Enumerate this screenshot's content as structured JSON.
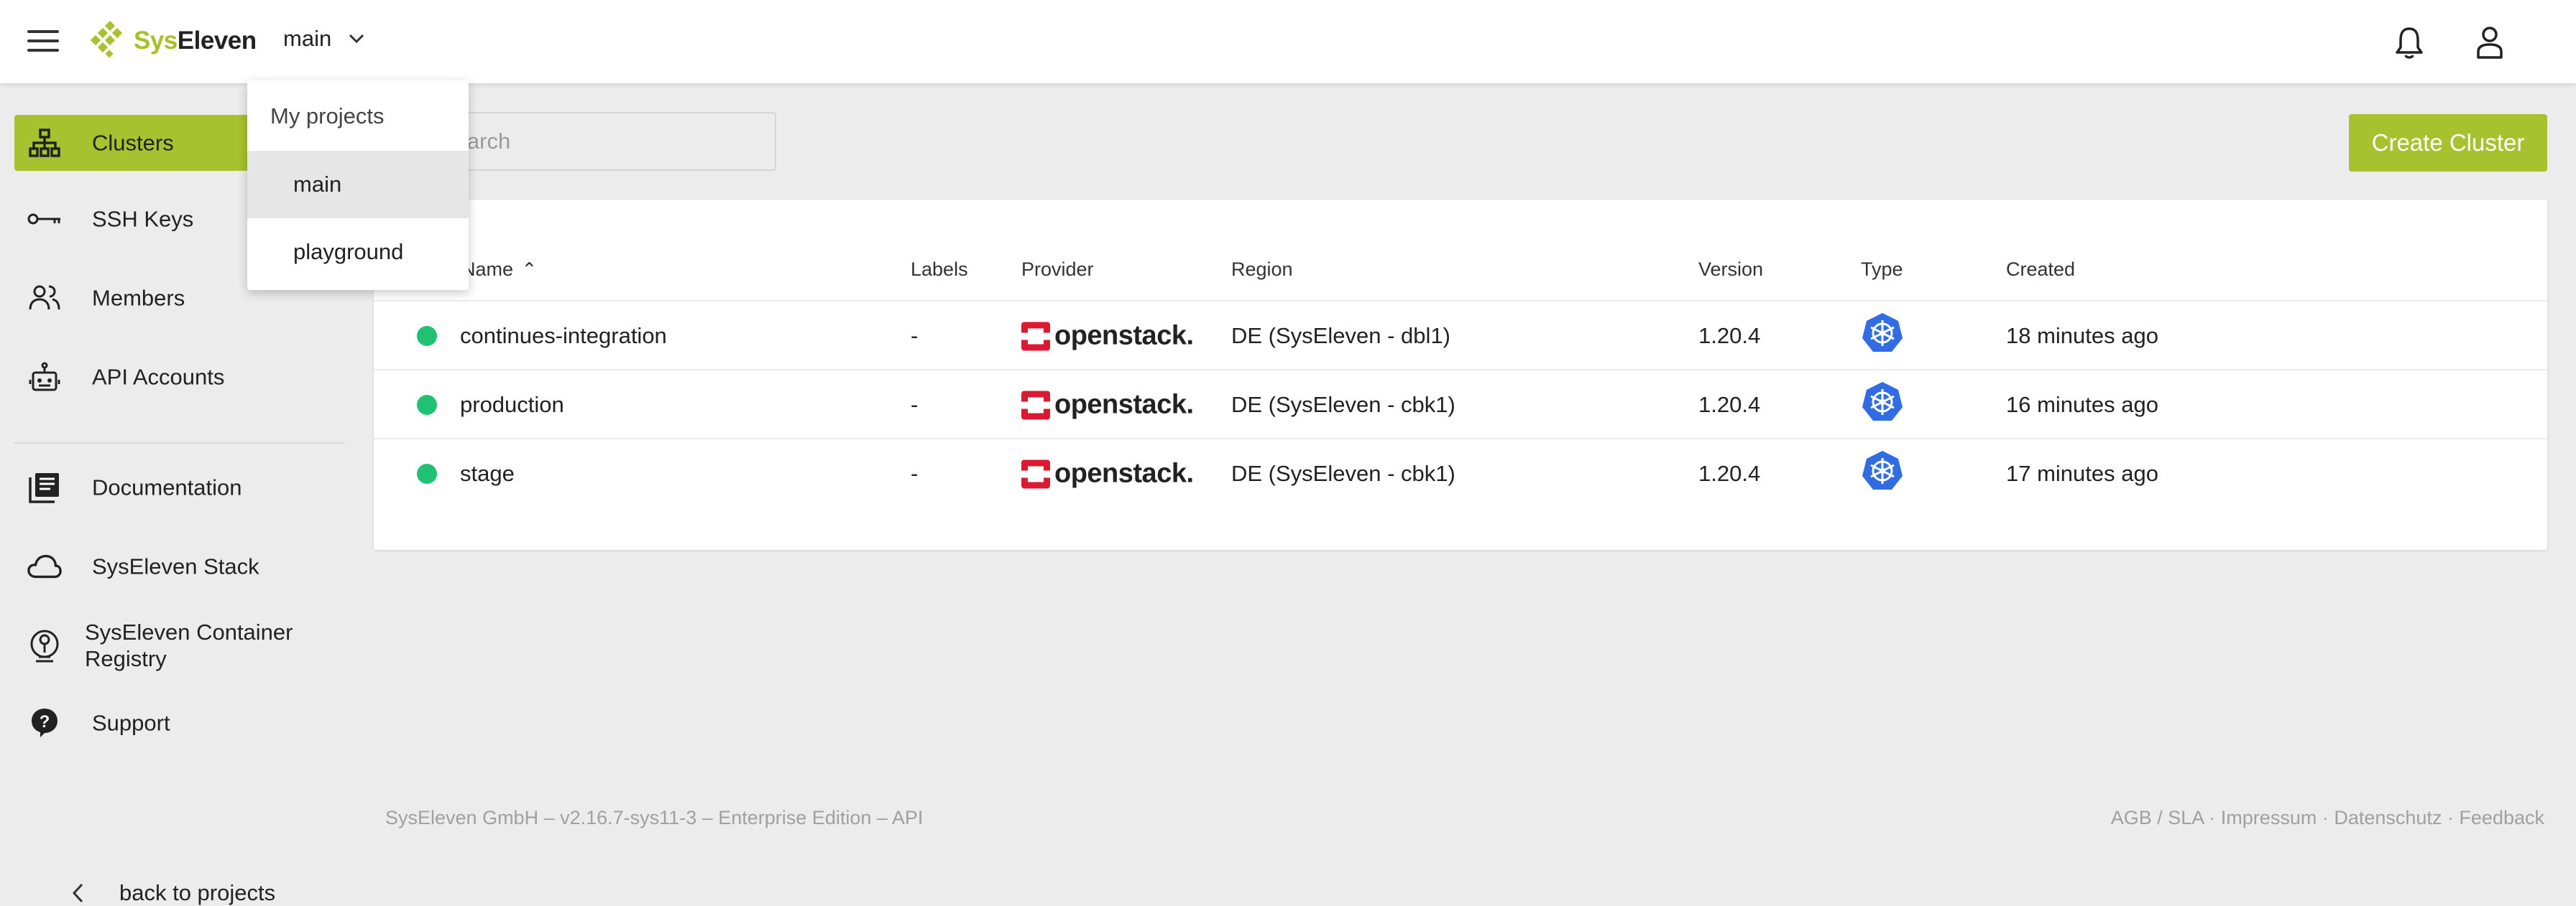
{
  "colors": {
    "accent": "#a6c22e",
    "status_ok": "#20c172",
    "openstack": "#da1a32",
    "kubernetes": "#326ce5"
  },
  "header": {
    "logo": {
      "part1": "Sys",
      "part2": "Eleven"
    },
    "project": "main",
    "icons": [
      "menu-icon",
      "bell-icon",
      "user-icon"
    ]
  },
  "sidebar": {
    "items": [
      {
        "label": "Clusters",
        "icon": "sitemap-icon",
        "active": true
      },
      {
        "label": "SSH Keys",
        "icon": "key-icon"
      },
      {
        "label": "Members",
        "icon": "members-icon"
      },
      {
        "label": "API Accounts",
        "icon": "robot-icon"
      },
      {
        "label": "Documentation",
        "icon": "book-icon"
      },
      {
        "label": "SysEleven Stack",
        "icon": "cloud-icon"
      },
      {
        "label": "SysEleven Container Registry",
        "icon": "registry-icon"
      },
      {
        "label": "Support",
        "icon": "help-icon"
      }
    ],
    "back": "back to projects"
  },
  "search": {
    "placeholder": "Search"
  },
  "create_button": "Create Cluster",
  "table": {
    "headers": {
      "name": "Name",
      "labels": "Labels",
      "provider": "Provider",
      "region": "Region",
      "version": "Version",
      "type": "Type",
      "created": "Created"
    },
    "sort_indicator": "^",
    "rows": [
      {
        "name": "continues-integration",
        "labels": "-",
        "provider": "openstack.",
        "region": "DE (SysEleven - dbl1)",
        "version": "1.20.4",
        "created": "18 minutes ago"
      },
      {
        "name": "production",
        "labels": "-",
        "provider": "openstack.",
        "region": "DE (SysEleven - cbk1)",
        "version": "1.20.4",
        "created": "16 minutes ago"
      },
      {
        "name": "stage",
        "labels": "-",
        "provider": "openstack.",
        "region": "DE (SysEleven - cbk1)",
        "version": "1.20.4",
        "created": "17 minutes ago"
      }
    ]
  },
  "footer": {
    "left": [
      "SysEleven GmbH",
      "v2.16.7-sys11-3",
      "Enterprise Edition",
      "API"
    ],
    "right": [
      "AGB / SLA",
      "Impressum",
      "Datenschutz",
      "Feedback"
    ]
  },
  "project_dropdown": {
    "title": "My projects",
    "items": [
      {
        "label": "main",
        "selected": true
      },
      {
        "label": "playground"
      }
    ]
  }
}
